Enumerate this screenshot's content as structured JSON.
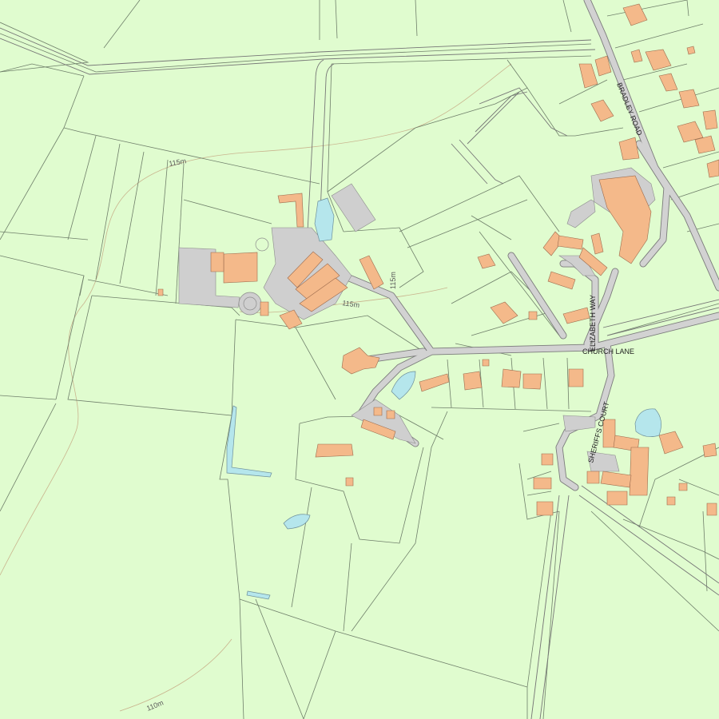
{
  "map": {
    "title": "",
    "colors": {
      "land": "#e0fccf",
      "building": "#f4b98a",
      "road": "#d2d2d2",
      "water": "#b5e6ec",
      "contour": "#c9b48e",
      "boundary": "#6f7f6a"
    },
    "street_labels": {
      "bradley_road": "BRADLEY ROAD",
      "church_lane": "CHURCH LANE",
      "elizabeth_way": "ELIZABETH WAY",
      "sheriffs_court": "SHERIFFS COURT"
    },
    "contour_labels": {
      "nw": "115m",
      "centre": "115m",
      "vertical": "115m",
      "south": "110m"
    }
  }
}
